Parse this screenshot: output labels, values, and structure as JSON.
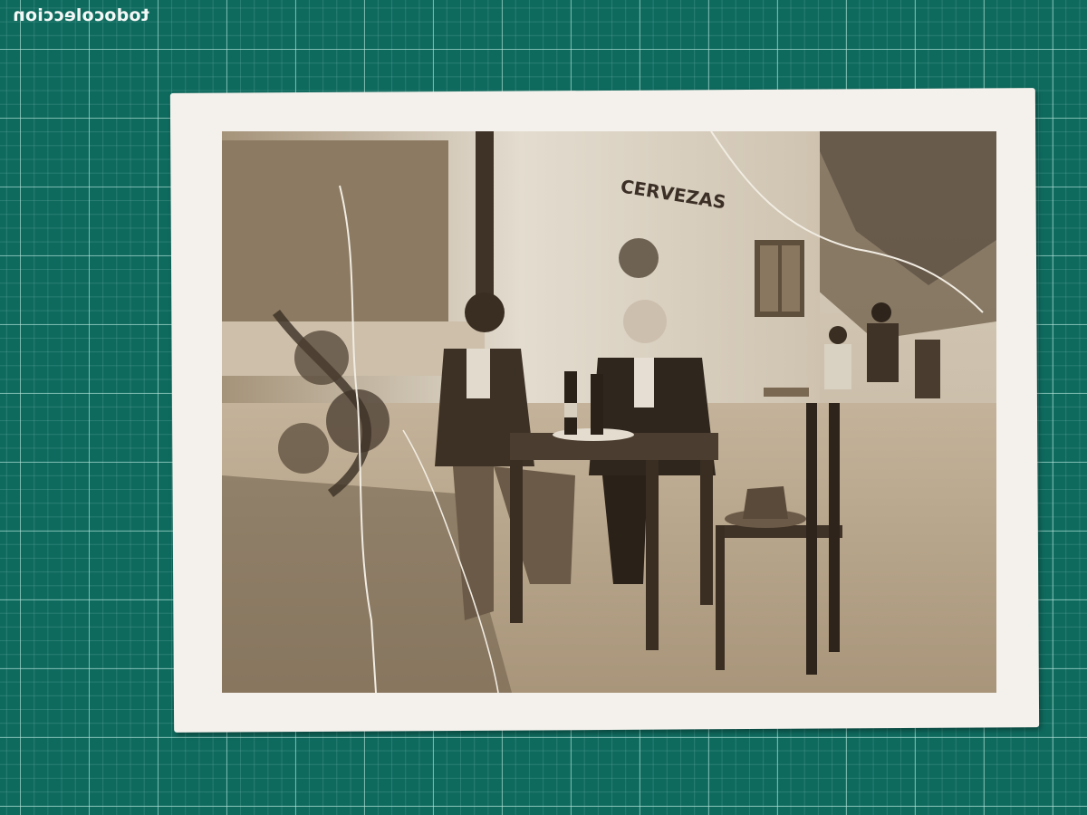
{
  "watermark": {
    "text": "todocoleccion"
  },
  "photo": {
    "sign_text": "CERVEZAS",
    "tone": {
      "highlight": "#e8e2d6",
      "midtone": "#9f8c72",
      "shadow": "#3a2e22"
    }
  }
}
